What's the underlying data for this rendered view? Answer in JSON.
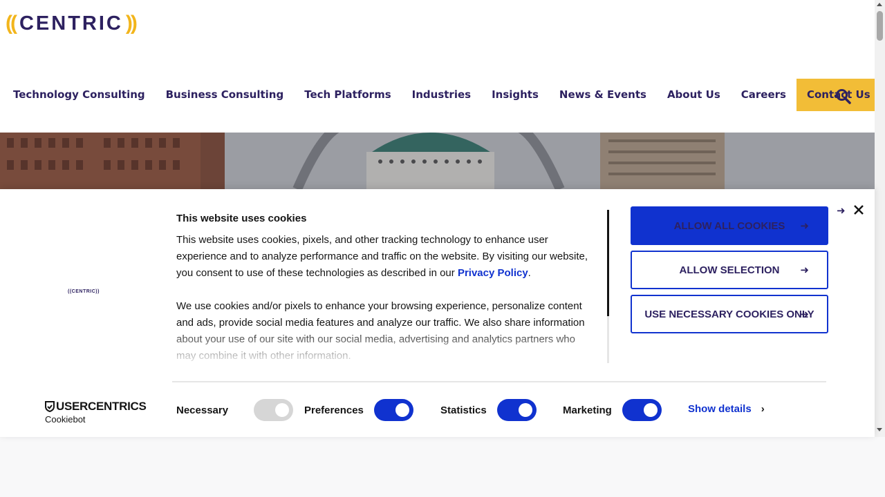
{
  "brand": {
    "logo_left": "((",
    "logo_word": "CENTRIC",
    "logo_right": "))",
    "accent": "#f2b51c",
    "primary": "#2d2160"
  },
  "nav": {
    "items": [
      {
        "label": "Technology Consulting"
      },
      {
        "label": "Business Consulting"
      },
      {
        "label": "Tech Platforms"
      },
      {
        "label": "Industries"
      },
      {
        "label": "Insights"
      },
      {
        "label": "News & Events"
      },
      {
        "label": "About Us"
      },
      {
        "label": "Careers"
      }
    ],
    "contact_label": "Contact Us",
    "search_icon": "search-icon"
  },
  "cookie_banner": {
    "logo_small": "((CENTRIC))",
    "title": "This website uses cookies",
    "paragraph1_pre": "This website uses cookies, pixels, and other tracking technology to enhance user experience and to analyze performance and traffic on the website. By visiting our website, you consent to use of these technologies as described in our ",
    "privacy_link": "Privacy Policy",
    "paragraph1_post": ".",
    "paragraph2": "We use cookies and/or pixels to enhance your browsing experience, personalize content and ads, provide social media features and analyze our traffic. We also share information about your use of our site with our social media, advertising and analytics partners who may combine it with other information.",
    "buttons": {
      "allow_all": "ALLOW ALL COOKIES",
      "allow_selection": "ALLOW SELECTION",
      "necessary_only": "USE NECESSARY COOKIES ONLY"
    },
    "powered_by_brand": "USERCENTRICS",
    "powered_by_sub": "Cookiebot",
    "consents": [
      {
        "label": "Necessary",
        "state": "on-disabled"
      },
      {
        "label": "Preferences",
        "state": "on"
      },
      {
        "label": "Statistics",
        "state": "on"
      },
      {
        "label": "Marketing",
        "state": "on"
      }
    ],
    "show_details": "Show details",
    "button_color": "#1032cf"
  }
}
